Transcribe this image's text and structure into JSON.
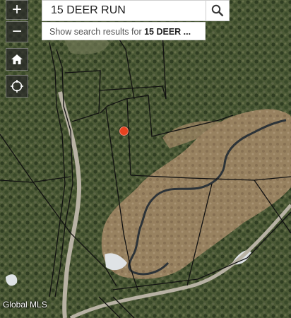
{
  "map": {
    "type": "aerial imagery with parcel boundaries",
    "line_color": "#111111",
    "marker_color": "#e8421f"
  },
  "search": {
    "query": "15 DEER RUN",
    "suggestion_prefix": "Show search results for ",
    "suggestion_bold": "15 DEER ...",
    "clear_icon": "close-icon",
    "search_icon": "search-icon"
  },
  "controls": {
    "zoom_in": "+",
    "zoom_out": "−",
    "home_icon": "home-icon",
    "locate_icon": "locate-icon"
  },
  "watermark": "Global MLS"
}
